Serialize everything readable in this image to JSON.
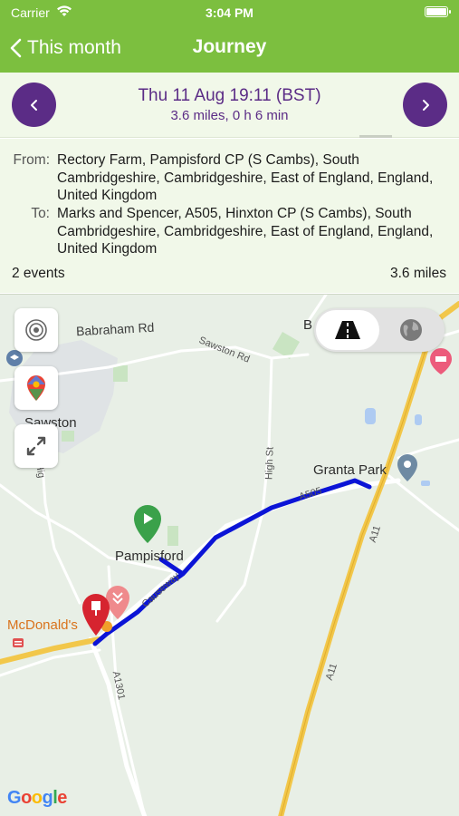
{
  "status_bar": {
    "carrier": "Carrier",
    "time": "3:04 PM"
  },
  "nav": {
    "back_label": "This month",
    "title": "Journey"
  },
  "summary": {
    "date": "Thu 11 Aug 19:11 (BST)",
    "sub": "3.6 miles, 0 h 6 min"
  },
  "details": {
    "from_label": "From:",
    "from_value": "Rectory Farm, Pampisford CP (S Cambs), South Cambridgeshire, Cambridgeshire, East of England, England, United Kingdom",
    "to_label": "To:",
    "to_value": "Marks and Spencer, A505, Hinxton CP (S Cambs), South Cambridgeshire, Cambridgeshire, East of England, England, United Kingdom",
    "events": "2 events",
    "distance": "3.6 miles"
  },
  "map": {
    "labels": {
      "babraham_rd": "Babraham Rd",
      "sawston_rd": "Sawston Rd",
      "sawston": "Sawston",
      "high_st": "High St",
      "high_left": "Hig",
      "granta_park": "Granta Park",
      "pampisford": "Pampisford",
      "a505": "A505",
      "a11": "A11",
      "a11_lower": "A11",
      "causeway": "Causeway",
      "a1301": "A1301",
      "mcdonalds": "McDonald's",
      "b_partial": "B"
    },
    "google_letters": [
      "G",
      "o",
      "o",
      "g",
      "l",
      "e"
    ]
  },
  "colors": {
    "header_green": "#7cbf3f",
    "accent_purple": "#5b2c86",
    "route_blue": "#0b14d6",
    "motorway_yellow": "#f2c74a"
  }
}
